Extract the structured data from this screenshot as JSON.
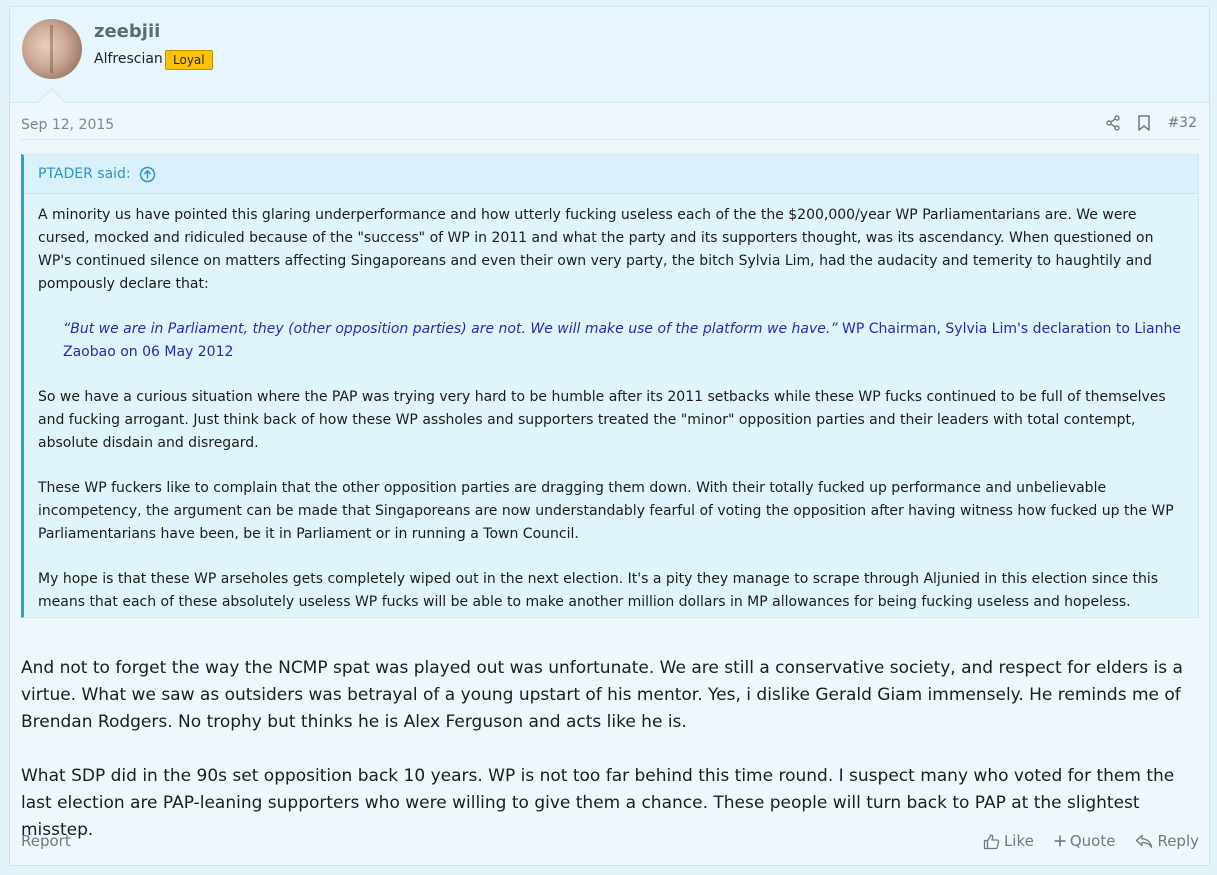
{
  "user": {
    "name": "zeebjii",
    "title": "Alfrescian",
    "badge": "Loyal"
  },
  "post": {
    "date": "Sep 12, 2015",
    "number": "#32"
  },
  "quote": {
    "author": "PTADER said:",
    "p1": "A minority us have pointed this glaring underperformance and how utterly fucking useless each of the the $200,000/year WP Parliamentarians are. We were cursed, mocked and ridiculed because of the \"success\" of WP in 2011 and what the party and its supporters thought, was its ascendancy. When questioned on WP's continued silence on matters affecting Singaporeans and even their own very party, the bitch Sylvia Lim, had the audacity and temerity to haughtily and pompously declare that:",
    "inner_italic": "“But we are in Parliament, they (other opposition parties) are not. We will make use of the platform we have.”",
    "inner_rest": " WP Chairman, Sylvia Lim's declaration to Lianhe Zaobao on 06 May 2012",
    "p2": "So we have a curious situation where the PAP was trying very hard to be humble after its 2011 setbacks while these WP fucks continued to be full of themselves and fucking arrogant. Just think back of how these WP assholes and supporters treated the \"minor\" opposition parties and their leaders with total contempt, absolute disdain and disregard.",
    "p3": "These WP fuckers like to complain that the other opposition parties are dragging them down. With their totally fucked up performance and unbelievable incompetency, the argument can be made that Singaporeans are now understandably fearful of voting the opposition after having witness how fucked up the WP Parliamentarians have been, be it in Parliament or in running a Town Council.",
    "p4": "My hope is that these WP arseholes gets completely wiped out in the next election. It's a pity they manage to scrape through Aljunied in this election since this means that each of these absolutely useless WP fucks will be able to make another million dollars in MP allowances for being fucking useless and hopeless."
  },
  "body": {
    "p1": "And not to forget the way the NCMP spat was played out was unfortunate. We are still a conservative society, and respect for elders is a virtue. What we saw as outsiders was betrayal of a young upstart of his mentor. Yes, i dislike Gerald Giam immensely. He reminds me of Brendan Rodgers. No trophy but thinks he is Alex Ferguson and acts like he is.",
    "p2": "What SDP did in the 90s set opposition back 10 years. WP is not too far behind this time round. I suspect many who voted for them the last election are PAP-leaning supporters who were willing to give them a chance. These people will turn back to PAP at the slightest misstep."
  },
  "footer": {
    "report": "Report",
    "like": "Like",
    "quote": "Quote",
    "reply": "Reply"
  },
  "icons": {
    "share": "share-icon",
    "bookmark": "bookmark-icon",
    "quote_up": "arrow-up-circle-icon",
    "like": "thumbs-up-icon",
    "quote": "plus-icon",
    "reply": "reply-icon"
  },
  "colors": {
    "accent": "#27a3d4",
    "badge": "#ffc107",
    "inner_quote": "#1e2eb3"
  }
}
